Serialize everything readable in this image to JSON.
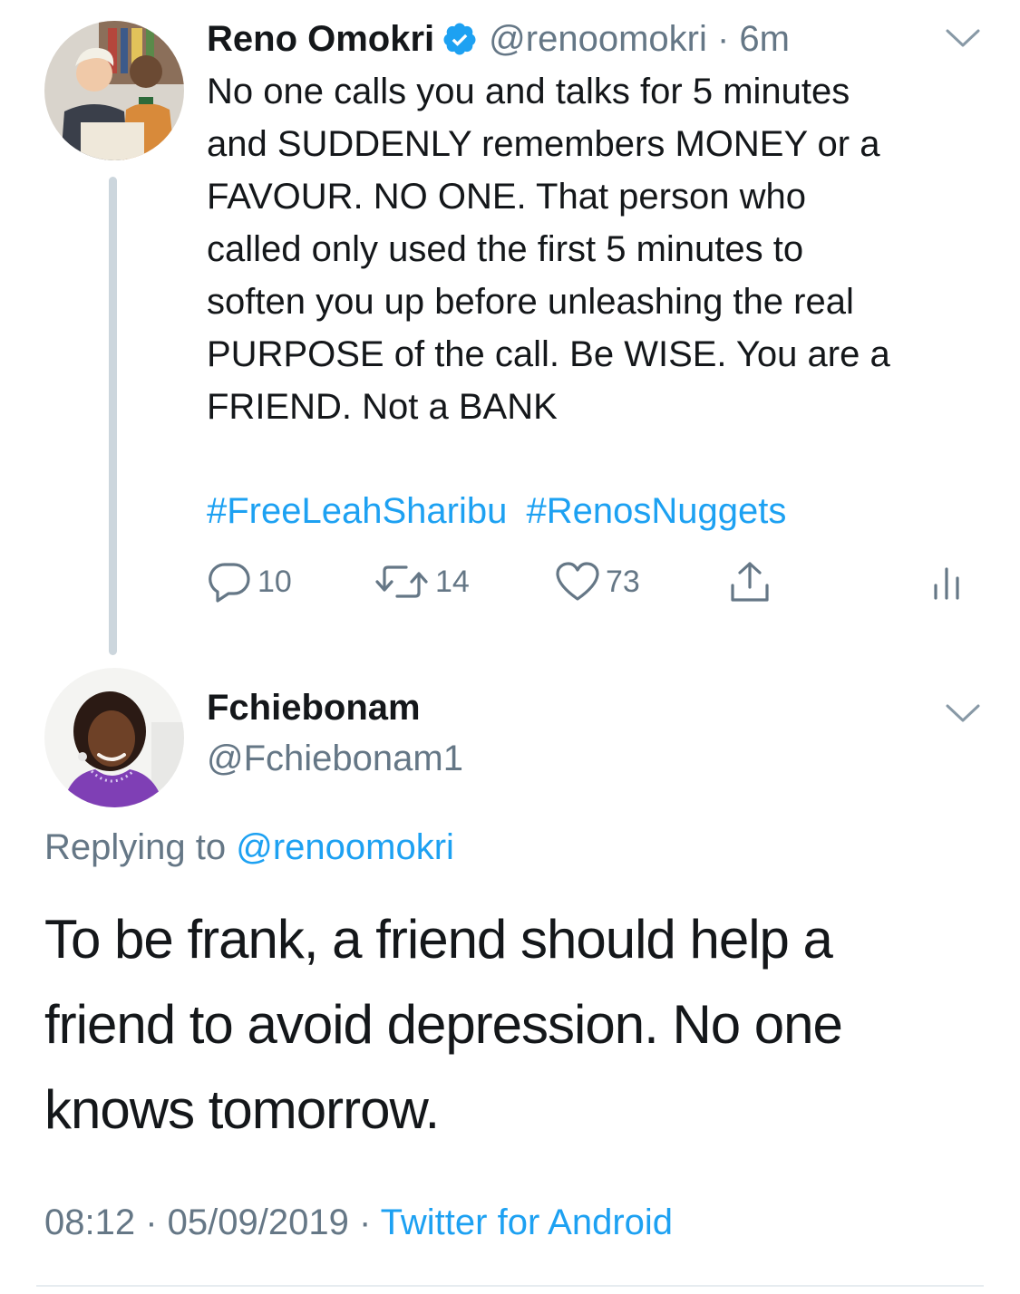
{
  "parent_tweet": {
    "display_name": "Reno Omokri",
    "handle_time": "@renoomokri · 6m",
    "text": "No one calls you and talks for 5 minutes\nand SUDDENLY remembers MONEY or a\nFAVOUR. NO ONE. That person who\ncalled only used the first 5 minutes to\nsoften you up before unleashing the real\nPURPOSE of the call. Be WISE. You are a\nFRIEND. Not a BANK",
    "hashtags": [
      "#FreeLeahSharibu",
      "#RenosNuggets"
    ],
    "actions": {
      "reply_count": "10",
      "retweet_count": "14",
      "like_count": "73"
    }
  },
  "reply_tweet": {
    "display_name": "Fchiebonam",
    "handle": "@Fchiebonam1",
    "replying_prefix": "Replying to",
    "replying_mention": "@renoomokri",
    "text": "To be frank,  a friend should help a\nfriend to avoid depression. No one\nknows tomorrow.",
    "timestamp": "08:12 · 05/09/2019 · ",
    "source": "Twitter for Android"
  },
  "colors": {
    "link": "#1da1f2",
    "secondary_text": "#657786",
    "primary_text": "#14171a",
    "thread_line": "#ccd6dd"
  },
  "icons": [
    "verified-badge-icon",
    "chevron-down-icon",
    "reply-icon",
    "retweet-icon",
    "like-icon",
    "share-icon",
    "analytics-icon"
  ]
}
